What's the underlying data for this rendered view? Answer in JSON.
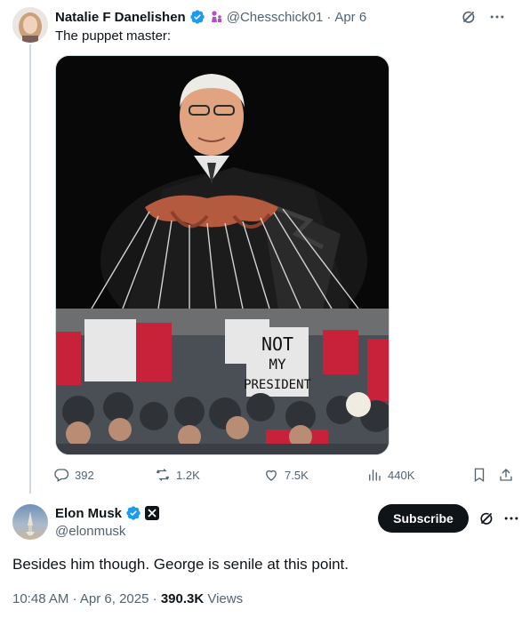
{
  "quoted_tweet": {
    "author_name": "Natalie F Danelishen",
    "handle": "@Chesschick01",
    "separator": "·",
    "date": "Apr 6",
    "text": "The puppet master:",
    "sign_text": {
      "line1": "NOT",
      "line2": "MY",
      "line3": "PRESIDENT"
    },
    "actions": {
      "replies": "392",
      "reposts": "1.2K",
      "likes": "7.5K",
      "views": "440K"
    }
  },
  "main_tweet": {
    "author_name": "Elon Musk",
    "handle": "@elonmusk",
    "subscribe_label": "Subscribe",
    "text": "Besides him though. George is senile at this point.",
    "time": "10:48 AM",
    "date": "Apr 6, 2025",
    "views_count": "390.3K",
    "views_label": "Views",
    "separator": "·"
  },
  "colors": {
    "verified_blue": "#1d9bf0",
    "text_primary": "#0f1419",
    "text_muted": "#536471",
    "border": "#cfd9de"
  },
  "icons": [
    "grok-icon",
    "more-icon",
    "reply-icon",
    "repost-icon",
    "like-icon",
    "views-icon",
    "bookmark-icon",
    "share-icon",
    "verified-icon",
    "x-badge-icon",
    "chess-icon"
  ]
}
